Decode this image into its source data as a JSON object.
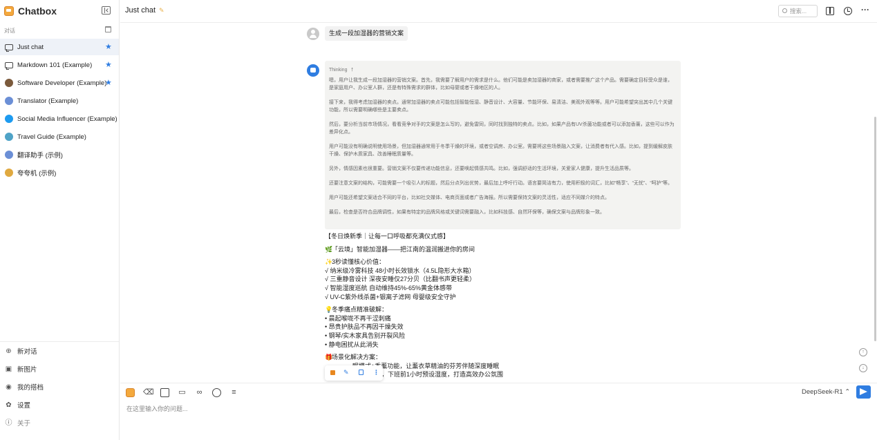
{
  "app": {
    "name": "Chatbox"
  },
  "sidebar": {
    "section_label": "对话",
    "chats": [
      {
        "label": "Just chat",
        "icon": "chat-bubble-icon",
        "starred": true,
        "active": true,
        "avatar_color": ""
      },
      {
        "label": "Markdown 101 (Example)",
        "icon": "chat-bubble-icon",
        "starred": true,
        "active": false,
        "avatar_color": ""
      },
      {
        "label": "Software Developer (Example)",
        "icon": "avatar-icon",
        "starred": true,
        "active": false,
        "avatar_color": "#7b5a3c"
      },
      {
        "label": "Translator (Example)",
        "icon": "avatar-icon",
        "starred": false,
        "active": false,
        "avatar_color": "#6b8fd6"
      },
      {
        "label": "Social Media Influencer (Example)",
        "icon": "avatar-icon",
        "starred": false,
        "active": false,
        "avatar_color": "#1d9bf0"
      },
      {
        "label": "Travel Guide (Example)",
        "icon": "avatar-icon",
        "starred": false,
        "active": false,
        "avatar_color": "#4fa3c7"
      },
      {
        "label": "翻译助手 (示例)",
        "icon": "avatar-icon",
        "starred": false,
        "active": false,
        "avatar_color": "#6b8fd6"
      },
      {
        "label": "夸夸机 (示例)",
        "icon": "avatar-icon",
        "starred": false,
        "active": false,
        "avatar_color": "#e0a940"
      }
    ],
    "star_glyph": "★",
    "bottom": {
      "new_chat": "新对话",
      "new_image": "新图片",
      "my_partners": "我的搭档",
      "settings": "设置",
      "about": "关于"
    }
  },
  "header": {
    "title": "Just chat",
    "search_placeholder": "搜索...",
    "more_glyph": "···"
  },
  "messages": {
    "user_text": "生成一段加湿器的营销文案",
    "thinking_label": "Thinking",
    "thinking_arrow": "↑",
    "thinking_paragraphs": [
      "嗯，用户让我生成一段加湿器的营销文案。首先，我需要了解用户的需求是什么。他们可能是卖加湿器的商家，或者需要推广这个产品。需要确定目标受众是谁，是家庭用户、办公室人群，还是有特殊需求的群体，比如母婴或者干燥地区的人。",
      "接下来，我得考虑加湿器的卖点。通常加湿器的卖点可能包括智能恒湿、静音设计、大容量、节能环保、易清洁、美观外观等等。用户可能希望突出其中几个关键功能，所以需要明确哪些是主要卖点。",
      "然后，要分析当前市场情况，看看竞争对手的文案是怎么写的，避免雷同，同时找到独特的卖点。比如，如果产品有UV杀菌功能或者可以添加香薰，这些可以作为差异化点。",
      "用户可能没有明确说明使用场景，但加湿器通常用于冬季干燥的环境，或者空调房、办公室。需要将这些场景融入文案，让消费者有代入感。比如，提到缓解皮肤干燥、保护木质家具、改善睡眠质量等。",
      "另外，情感因素也很重要。营销文案不仅要传递功能信息，还要唤起情感共鸣。比如，强调舒适的生活环境，关爱家人健康，提升生活品质等。",
      "还要注意文案的结构，可能需要一个吸引人的标题，然后分点列出优势，最后加上呼吁行动。语言要简洁有力，使用积极的词汇，比如“畅享”、“无忧”、“呵护”等。",
      "用户可能还希望文案适合不同的平台，比如社交媒体、电商页面或者广告海报。所以需要保持文案的灵活性，适应不同媒介的特点。",
      "最后，检查是否符合品牌调性，如果有特定的品牌风格或关键词需要融入，比如科技感、自然环保等，确保文案与品牌形象一致。"
    ],
    "answer_lines": [
      {
        "emoji": "",
        "text": "【冬日焕新季｜让每一口呼吸都充满仪式感】",
        "gap_before": false
      },
      {
        "emoji": "🌿",
        "text": "「云境」智能加湿器——把江南的温润搬进你的房间",
        "gap_before": true
      },
      {
        "emoji": "✨",
        "text": "3秒读懂核心价值：",
        "gap_before": true
      },
      {
        "emoji": "",
        "text": "√ 纳米级冷雾科技 48小时长效锁水（4.5L隐形大水箱）",
        "gap_before": false
      },
      {
        "emoji": "",
        "text": "√ 三重静音设计 深夜安睡仅27分贝（比翻书声更轻柔）",
        "gap_before": false
      },
      {
        "emoji": "",
        "text": "√ 智能湿度巡航 自动维持45%-65%黄金体感带",
        "gap_before": false
      },
      {
        "emoji": "",
        "text": "√ UV-C紫外线杀菌+银离子滤网 母婴级安全守护",
        "gap_before": false
      },
      {
        "emoji": "💡",
        "text": "冬季痛点精准破解：",
        "gap_before": true
      },
      {
        "emoji": "",
        "text": "• 晨起喉咙不再干涩刺痛",
        "gap_before": false
      },
      {
        "emoji": "",
        "text": "• 昂贵护肤品不再因干燥失效",
        "gap_before": false
      },
      {
        "emoji": "",
        "text": "• 钢琴/实木家具告别开裂风险",
        "gap_before": false
      },
      {
        "emoji": "",
        "text": "• 静电困扰从此消失",
        "gap_before": false
      },
      {
        "emoji": "🎁",
        "text": "场景化解决方案：",
        "gap_before": true
      },
      {
        "emoji": "",
        "text": "                眠模式+香薰功能，让薰衣草精油的芬芳伴随深度睡眠",
        "gap_before": false
      },
      {
        "emoji": "",
        "text": "                P远程控制，下班前1小时预设湿度，打造高效办公氛围",
        "gap_before": false
      }
    ]
  },
  "input": {
    "placeholder": "在这里输入你的问题...",
    "model": "DeepSeek-R1 ⌃"
  },
  "colors": {
    "accent": "#2f7de1",
    "brand": "#f4a93d",
    "active_bg": "#eef2f8",
    "thinking_bg": "#f3f3f1"
  }
}
